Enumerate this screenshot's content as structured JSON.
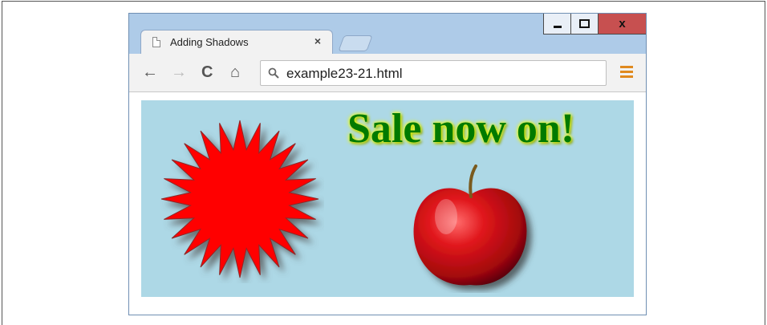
{
  "window": {
    "controls": {
      "minimize_icon": "minimize-icon",
      "maximize_icon": "maximize-icon",
      "close_label": "x"
    }
  },
  "tab": {
    "title": "Adding Shadows",
    "close_label": "×",
    "page_icon": "page-icon"
  },
  "toolbar": {
    "back_icon": "←",
    "forward_icon": "→",
    "reload_icon": "C",
    "home_icon": "⌂",
    "url": "example23-21.html",
    "menu_icon": "menu-icon"
  },
  "content": {
    "headline": "Sale now on!",
    "colors": {
      "background": "#add8e6",
      "star": "#ff0000",
      "headline": "#007a00",
      "glow": "#e7ff00"
    }
  }
}
